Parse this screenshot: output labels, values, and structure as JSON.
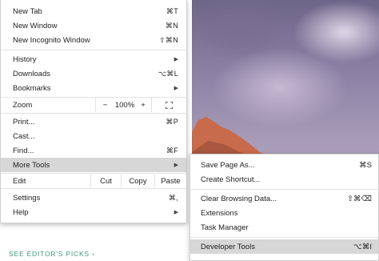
{
  "background": {
    "editors_link": "SEE EDITOR'S PICKS ›"
  },
  "menu": {
    "new_tab": {
      "label": "New Tab",
      "shortcut": "⌘T"
    },
    "new_window": {
      "label": "New Window",
      "shortcut": "⌘N"
    },
    "new_incognito": {
      "label": "New Incognito Window",
      "shortcut": "⇧⌘N"
    },
    "history": {
      "label": "History"
    },
    "downloads": {
      "label": "Downloads",
      "shortcut": "⌥⌘L"
    },
    "bookmarks": {
      "label": "Bookmarks"
    },
    "zoom": {
      "label": "Zoom",
      "minus": "−",
      "level": "100%",
      "plus": "+"
    },
    "print": {
      "label": "Print...",
      "shortcut": "⌘P"
    },
    "cast": {
      "label": "Cast..."
    },
    "find": {
      "label": "Find...",
      "shortcut": "⌘F"
    },
    "more_tools": {
      "label": "More Tools"
    },
    "edit": {
      "label": "Edit",
      "cut": "Cut",
      "copy": "Copy",
      "paste": "Paste"
    },
    "settings": {
      "label": "Settings",
      "shortcut": "⌘,"
    },
    "help": {
      "label": "Help"
    }
  },
  "submenu": {
    "save_page": {
      "label": "Save Page As...",
      "shortcut": "⌘S"
    },
    "create_shortcut": {
      "label": "Create Shortcut..."
    },
    "clear_browsing": {
      "label": "Clear Browsing Data...",
      "shortcut": "⇧⌘⌫"
    },
    "extensions": {
      "label": "Extensions"
    },
    "task_manager": {
      "label": "Task Manager"
    },
    "developer_tools": {
      "label": "Developer Tools",
      "shortcut": "⌥⌘I"
    }
  }
}
